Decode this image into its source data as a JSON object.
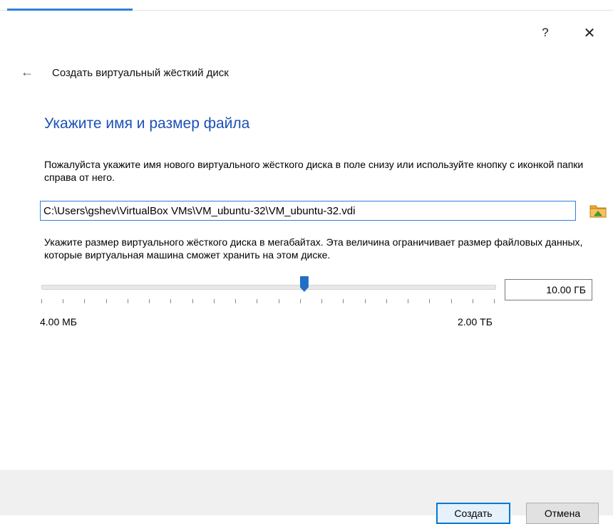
{
  "window": {
    "help_label": "?",
    "close_label": "✕"
  },
  "wizard": {
    "back_icon": "←",
    "title": "Создать виртуальный жёсткий диск",
    "heading": "Укажите имя и размер файла",
    "name_description": "Пожалуйста укажите имя нового виртуального жёсткого диска в поле снизу или используйте кнопку с иконкой папки справа от него.",
    "file_path": "C:\\Users\\gshev\\VirtualBox VMs\\VM_ubuntu-32\\VM_ubuntu-32.vdi",
    "size_description": "Укажите размер виртуального жёсткого диска в мегабайтах. Эта величина ограничивает размер файловых данных, которые виртуальная машина сможет хранить на этом диске.",
    "size_value": "10.00 ГБ",
    "size_slider_fraction": 0.58,
    "size_min_label": "4.00 МБ",
    "size_max_label": "2.00 ТБ"
  },
  "buttons": {
    "create": "Создать",
    "cancel": "Отмена"
  },
  "colors": {
    "heading": "#1c50b8",
    "accent": "#2f7fd8",
    "slider_thumb": "#1f6fc5",
    "folder_icon": "#f0a830"
  }
}
